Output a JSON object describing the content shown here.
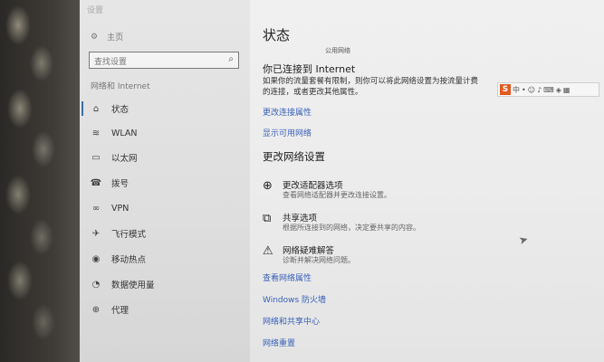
{
  "window": {
    "title": "设置"
  },
  "sidebar": {
    "home_label": "主页",
    "search_placeholder": "查找设置",
    "section_title": "网络和 Internet",
    "items": [
      {
        "label": "状态",
        "icon": "home-icon"
      },
      {
        "label": "WLAN",
        "icon": "wifi-icon"
      },
      {
        "label": "以太网",
        "icon": "ethernet-icon"
      },
      {
        "label": "拨号",
        "icon": "phone-icon"
      },
      {
        "label": "VPN",
        "icon": "vpn-icon"
      },
      {
        "label": "飞行模式",
        "icon": "airplane-icon"
      },
      {
        "label": "移动热点",
        "icon": "hotspot-icon"
      },
      {
        "label": "数据使用量",
        "icon": "data-usage-icon"
      },
      {
        "label": "代理",
        "icon": "globe-icon"
      }
    ]
  },
  "main": {
    "title": "状态",
    "network_name": "公用网络",
    "connected_heading": "你已连接到 Internet",
    "connected_desc": "如果你的流量套餐有限制，则你可以将此网络设置为按流量计费的连接，或者更改其他属性。",
    "links_top": [
      "更改连接属性",
      "显示可用网络"
    ],
    "change_heading": "更改网络设置",
    "options": [
      {
        "title": "更改适配器选项",
        "desc": "查看网络适配器并更改连接设置。",
        "icon": "adapter-icon"
      },
      {
        "title": "共享选项",
        "desc": "根据所连接到的网络，决定要共享的内容。",
        "icon": "sharing-icon"
      },
      {
        "title": "网络疑难解答",
        "desc": "诊断并解决网络问题。",
        "icon": "warning-icon"
      }
    ],
    "links_bottom": [
      "查看网络属性",
      "Windows 防火墙",
      "网络和共享中心",
      "网络重置"
    ]
  },
  "ime_toolbar": {
    "logo": "S",
    "mode": "中"
  },
  "colors": {
    "link": "#3a62b8",
    "accent": "#3a6ea5"
  }
}
